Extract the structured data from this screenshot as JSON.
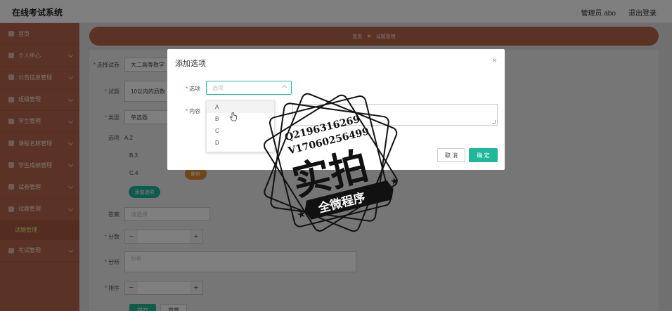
{
  "header": {
    "app_title": "在线考试系统",
    "user_label": "管理员 abo",
    "logout_label": "退出登录"
  },
  "sidebar": {
    "items": [
      {
        "label": "首页",
        "icon": "home-icon"
      },
      {
        "label": "个人中心",
        "icon": "user-icon"
      },
      {
        "label": "公告信息管理",
        "icon": "notice-icon"
      },
      {
        "label": "班级管理",
        "icon": "class-icon"
      },
      {
        "label": "学生管理",
        "icon": "student-icon"
      },
      {
        "label": "课程名称管理",
        "icon": "course-icon"
      },
      {
        "label": "学生成绩管理",
        "icon": "grade-icon"
      },
      {
        "label": "试卷管理",
        "icon": "paper-icon"
      },
      {
        "label": "试题管理",
        "icon": "question-icon"
      }
    ],
    "active_sub": "试题管理",
    "last_item": {
      "label": "考试管理",
      "icon": "exam-icon"
    }
  },
  "breadcrumb": {
    "home": "首页",
    "current": "试题管理"
  },
  "form": {
    "paper_label": "选择试卷",
    "paper_value": "大二高等数学",
    "question_label": "试题",
    "question_value": "10以内的质数",
    "type_label": "类型",
    "type_value": "单选题",
    "options_label": "选项",
    "options": [
      "A.2",
      "B.3",
      "C.4"
    ],
    "delete_label": "删除",
    "add_option_label": "添加选项",
    "answer_label": "答案",
    "answer_placeholder": "请选择",
    "score_label": "分数",
    "analysis_label": "分析",
    "analysis_placeholder": "分析",
    "order_label": "排序",
    "submit_label": "提交",
    "reset_label": "重置"
  },
  "modal": {
    "title": "添加选项",
    "option_label": "选项",
    "option_placeholder": "选项",
    "content_label": "内容",
    "cancel_label": "取 消",
    "confirm_label": "确 定",
    "dropdown_options": [
      "A",
      "B",
      "C",
      "D"
    ]
  },
  "watermark": {
    "line1": "Q2196316269",
    "line2": "V17060256499",
    "big_text": "实拍",
    "banner": "全微程序"
  },
  "colors": {
    "sidebar": "#b7654d",
    "accent": "#1fb89a",
    "delete": "#e08a2e"
  }
}
